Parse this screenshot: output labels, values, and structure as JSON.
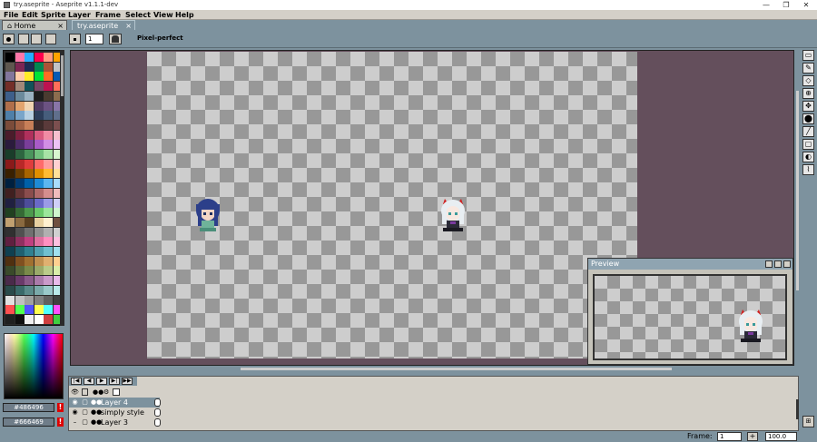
{
  "window": {
    "title": "try.aseprite - Aseprite v1.1.1-dev",
    "minimize": "—",
    "maximize": "❐",
    "close": "✕"
  },
  "menu": [
    "File",
    "Edit",
    "Sprite",
    "Layer",
    "Frame",
    "Select",
    "View",
    "Help"
  ],
  "tabs": {
    "home": "Home",
    "doc": "try.aseprite",
    "close_glyph": "×"
  },
  "context": {
    "pixel_perfect": "Pixel-perfect",
    "brush_size": "1"
  },
  "colors": {
    "fg": "#486496",
    "bg": "#666469",
    "warn_glyph": "!"
  },
  "palette": [
    "#000000",
    "#ff77a8",
    "#29adff",
    "#ff004d",
    "#ff9d81",
    "#ffa300",
    "#5f574f",
    "#7e2553",
    "#1d2b53",
    "#008751",
    "#ab5236",
    "#c2c3c7",
    "#83769c",
    "#ffccaa",
    "#ffec27",
    "#00e436",
    "#ff6c24",
    "#065ab5",
    "#742f29",
    "#a28879",
    "#125359",
    "#754665",
    "#be1250",
    "#ff6e59",
    "#3e5f8a",
    "#6b8a9c",
    "#9bb3c2",
    "#1d1d1d",
    "#4a3b30",
    "#8c6d4e",
    "#b06f4b",
    "#e3a46e",
    "#f1d5b3",
    "#513c65",
    "#6b5282",
    "#8875a8",
    "#4f7fa8",
    "#7aa5c9",
    "#b8d0e2",
    "#2c3d5a",
    "#465d7c",
    "#606f8c",
    "#7b4c3a",
    "#a06044",
    "#c87f58",
    "#3d2a2a",
    "#5a3a3a",
    "#7c4f4f",
    "#4b1c2b",
    "#7d2040",
    "#b0305c",
    "#d85a7f",
    "#f08ca4",
    "#f7c0cf",
    "#2b1b3d",
    "#4d2b69",
    "#7a3e9a",
    "#a85bc8",
    "#d18ee6",
    "#ecc3f5",
    "#1a3d2a",
    "#2d6540",
    "#4a955c",
    "#72c17e",
    "#a7e3a6",
    "#d8f7d0",
    "#8a1a1a",
    "#b82828",
    "#e03c3c",
    "#ff6b6b",
    "#ff9e9e",
    "#ffd1d1",
    "#3a2000",
    "#6b3d00",
    "#a86400",
    "#e08f00",
    "#ffbb33",
    "#ffe199",
    "#00203f",
    "#003b73",
    "#0060a8",
    "#1f8bd6",
    "#5cb6f0",
    "#a9dcfb",
    "#402020",
    "#653535",
    "#8a4d4d",
    "#b06a6a",
    "#d48e8e",
    "#f0bcbc",
    "#202040",
    "#35356a",
    "#4d4d99",
    "#6a6ac8",
    "#9b9be6",
    "#cfcff7",
    "#204020",
    "#356a35",
    "#4d994d",
    "#6ac86a",
    "#9be69b",
    "#cff7cf",
    "#c0a070",
    "#8a6a40",
    "#5a4020",
    "#e8d0a0",
    "#fff0d0",
    "#705040",
    "#303030",
    "#505050",
    "#707070",
    "#909090",
    "#b0b0b0",
    "#d0d0d0",
    "#602040",
    "#903060",
    "#c04080",
    "#e070a0",
    "#ff90c0",
    "#ffc0e0",
    "#104050",
    "#206070",
    "#308090",
    "#50a0b0",
    "#70c0d0",
    "#a0e0f0",
    "#503010",
    "#805020",
    "#a07030",
    "#c09050",
    "#e0b070",
    "#ffd090",
    "#3a4a2a",
    "#5a6a3a",
    "#7a8a4a",
    "#9aaa6a",
    "#bacc8a",
    "#daeeaa",
    "#4a2a4a",
    "#6a3a6a",
    "#8a5a8a",
    "#aa7aaa",
    "#ca9aca",
    "#eabaea",
    "#2a4a4a",
    "#3a6a6a",
    "#5a8a8a",
    "#7aaaaa",
    "#9acaca",
    "#baeaea",
    "#e0e0e0",
    "#c0c0c0",
    "#a0a0a0",
    "#808080",
    "#606060",
    "#404040",
    "#ff5050",
    "#50ff50",
    "#5050ff",
    "#ffff50",
    "#50ffff",
    "#ff50ff",
    "#202020",
    "#101010",
    "#f0f0f0",
    "#ffffff",
    "#d04040",
    "#40d040"
  ],
  "preview": {
    "title": "Preview"
  },
  "tools": [
    "▭",
    "✎",
    "◇",
    "⊕",
    "✥",
    "⬤",
    "╱",
    "▢",
    "◐",
    "⌇"
  ],
  "timeline": {
    "buttons": [
      "|◀",
      "◀",
      "▶",
      "▶|",
      "▶▶"
    ],
    "layers": [
      {
        "name": "Layer 4",
        "selected": true
      },
      {
        "name": "simply style",
        "selected": false
      },
      {
        "name": "Layer 3",
        "selected": false
      }
    ]
  },
  "status": {
    "frame_label": "Frame:",
    "frame_value": "1",
    "plus": "+",
    "zoom": "100.0"
  }
}
